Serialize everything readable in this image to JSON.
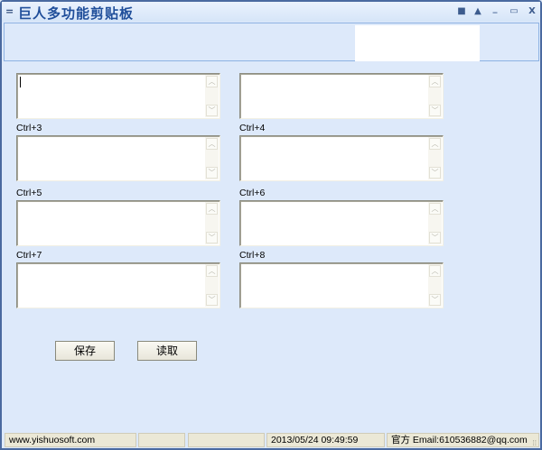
{
  "window": {
    "title": "巨人多功能剪贴板",
    "menu_icon": "=",
    "controls": {
      "pin": "■",
      "up": "▲",
      "minimize": "_",
      "maximize": "▭",
      "close": "X"
    }
  },
  "slots": [
    {
      "label": ""
    },
    {
      "label": ""
    },
    {
      "label": "Ctrl+3"
    },
    {
      "label": "Ctrl+4"
    },
    {
      "label": "Ctrl+5"
    },
    {
      "label": "Ctrl+6"
    },
    {
      "label": "Ctrl+7"
    },
    {
      "label": "Ctrl+8"
    }
  ],
  "buttons": {
    "save": "保存",
    "read": "读取"
  },
  "status": {
    "website": "www.yishuosoft.com",
    "seg2": "",
    "seg3": "",
    "datetime": "2013/05/24 09:49:59",
    "contact": "官方 Email:610536882@qq.com"
  }
}
